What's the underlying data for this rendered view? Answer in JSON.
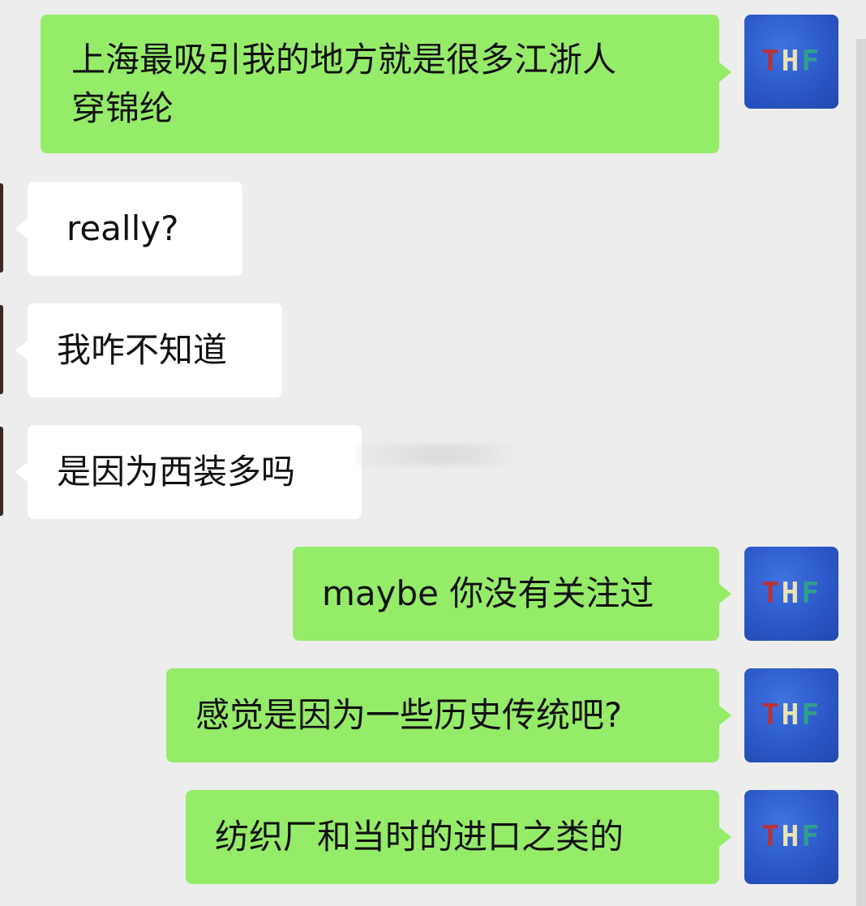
{
  "messages": [
    {
      "side": "sent",
      "text": "上海最吸引我的地方就是很多江浙人\n穿锦纶",
      "avatar": "avatar-thf-icon"
    },
    {
      "side": "received",
      "text": "really?"
    },
    {
      "side": "received",
      "text": "我咋不知道"
    },
    {
      "side": "received",
      "text": "是因为西装多吗"
    },
    {
      "side": "sent",
      "text": "maybe 你没有关注过",
      "avatar": "avatar-thf-icon"
    },
    {
      "side": "sent",
      "text": "感觉是因为一些历史传统吧?",
      "avatar": "avatar-thf-icon"
    },
    {
      "side": "sent",
      "text": "纺织厂和当时的进口之类的",
      "avatar": "avatar-thf-icon"
    }
  ],
  "avatar": {
    "letters": [
      "T",
      "H",
      "F"
    ],
    "colors": {
      "background": "#2a56c6",
      "t": "#b8323a",
      "h": "#e9e3b5",
      "f": "#2f9f8c"
    }
  },
  "colors": {
    "background": "#ededed",
    "sent_bubble": "#95ec69",
    "received_bubble": "#ffffff",
    "text": "#111111"
  }
}
